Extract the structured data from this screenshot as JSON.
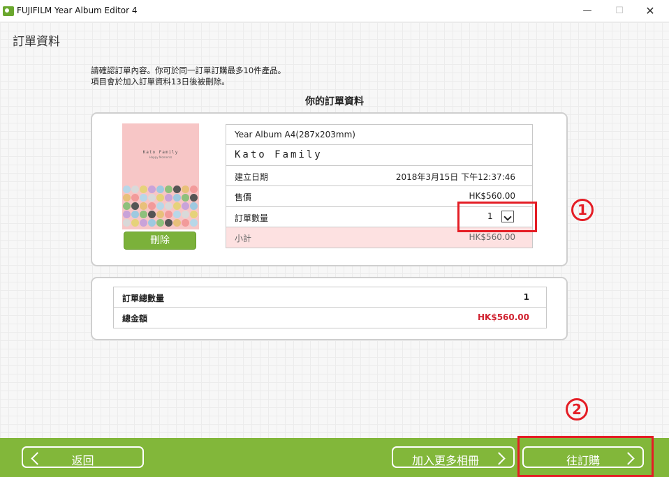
{
  "window": {
    "title": "FUJIFILM Year Album Editor 4",
    "min": "—",
    "max": "☐",
    "close": "✕"
  },
  "page": {
    "title": "訂單資料",
    "instructions": [
      "請確認訂單內容。你可於同一訂單訂購最多10件產品。",
      "項目會於加入訂單資料13日後被刪除。"
    ],
    "section_title": "你的訂單資料"
  },
  "order": {
    "cover": {
      "title": "Kato Family",
      "subtitle": "Happy Moments"
    },
    "delete_label": "刪除",
    "product": "Year Album A4(287x203mm)",
    "album_name": "Kato Family",
    "created_label": "建立日期",
    "created_value": "2018年3月15日 下午12:37:46",
    "price_label": "售價",
    "price_value": "HK$560.00",
    "qty_label": "訂單數量",
    "qty_value": "1",
    "subtotal_label": "小計",
    "subtotal_value": "HK$560.00"
  },
  "totals": {
    "count_label": "訂單總數量",
    "count_value": "1",
    "amount_label": "總金額",
    "amount_value": "HK$560.00"
  },
  "annotations": {
    "one": "1",
    "two": "2"
  },
  "footer": {
    "back_label": "返回",
    "more_label": "加入更多相冊",
    "order_label": "往訂購"
  },
  "colors": {
    "accent_green": "#82b73a",
    "highlight_red": "#e41d25",
    "price_red": "#d0212f",
    "cover_pink": "#f7c6c6"
  },
  "icons": {
    "back": "chevron-left-icon",
    "next": "chevron-right-icon",
    "dropdown": "chevron-down-icon"
  }
}
